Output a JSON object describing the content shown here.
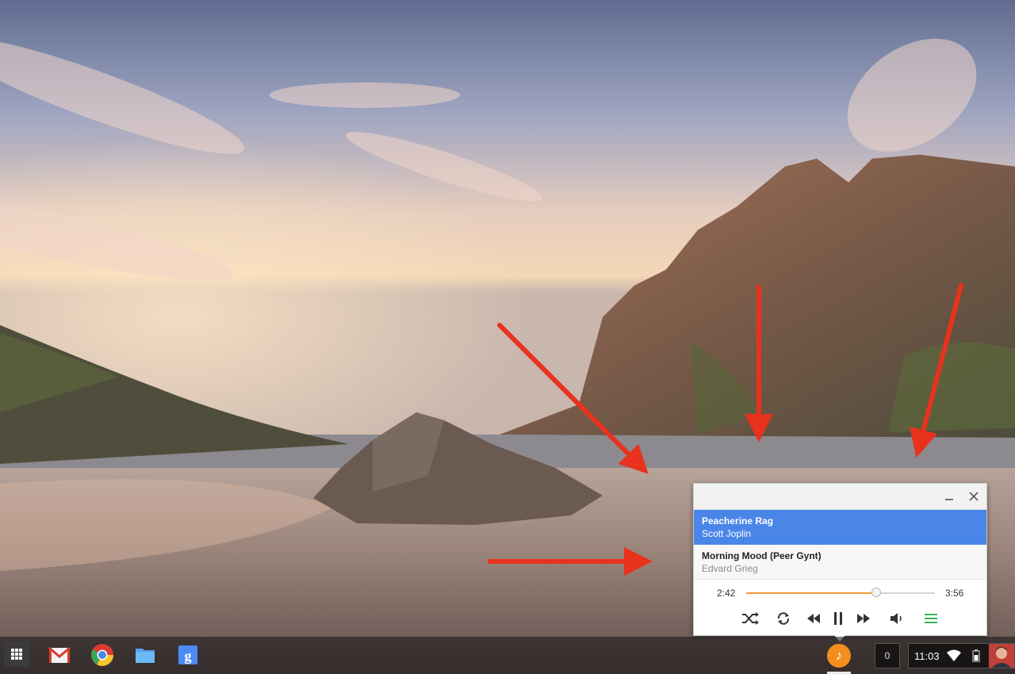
{
  "player": {
    "tracks": [
      {
        "title": "Peacherine Rag",
        "artist": "Scott Joplin",
        "active": true
      },
      {
        "title": "Morning Mood (Peer Gynt)",
        "artist": "Edvard Grieg",
        "active": false
      }
    ],
    "current_time": "2:42",
    "total_time": "3:56",
    "progress_fraction": 0.69,
    "accent_color": "#f2992e",
    "selection_color": "#4a86e8",
    "controls": [
      "shuffle-icon",
      "repeat-icon",
      "rewind-icon",
      "pause-icon",
      "fast-forward-icon",
      "volume-icon",
      "playlist-icon"
    ]
  },
  "shelf": {
    "apps": [
      "app-launcher-icon",
      "gmail-icon",
      "chrome-icon",
      "files-icon",
      "google-search-icon"
    ],
    "music_tray_glyph": "♪",
    "notification_count": "0",
    "clock": "11:03"
  }
}
